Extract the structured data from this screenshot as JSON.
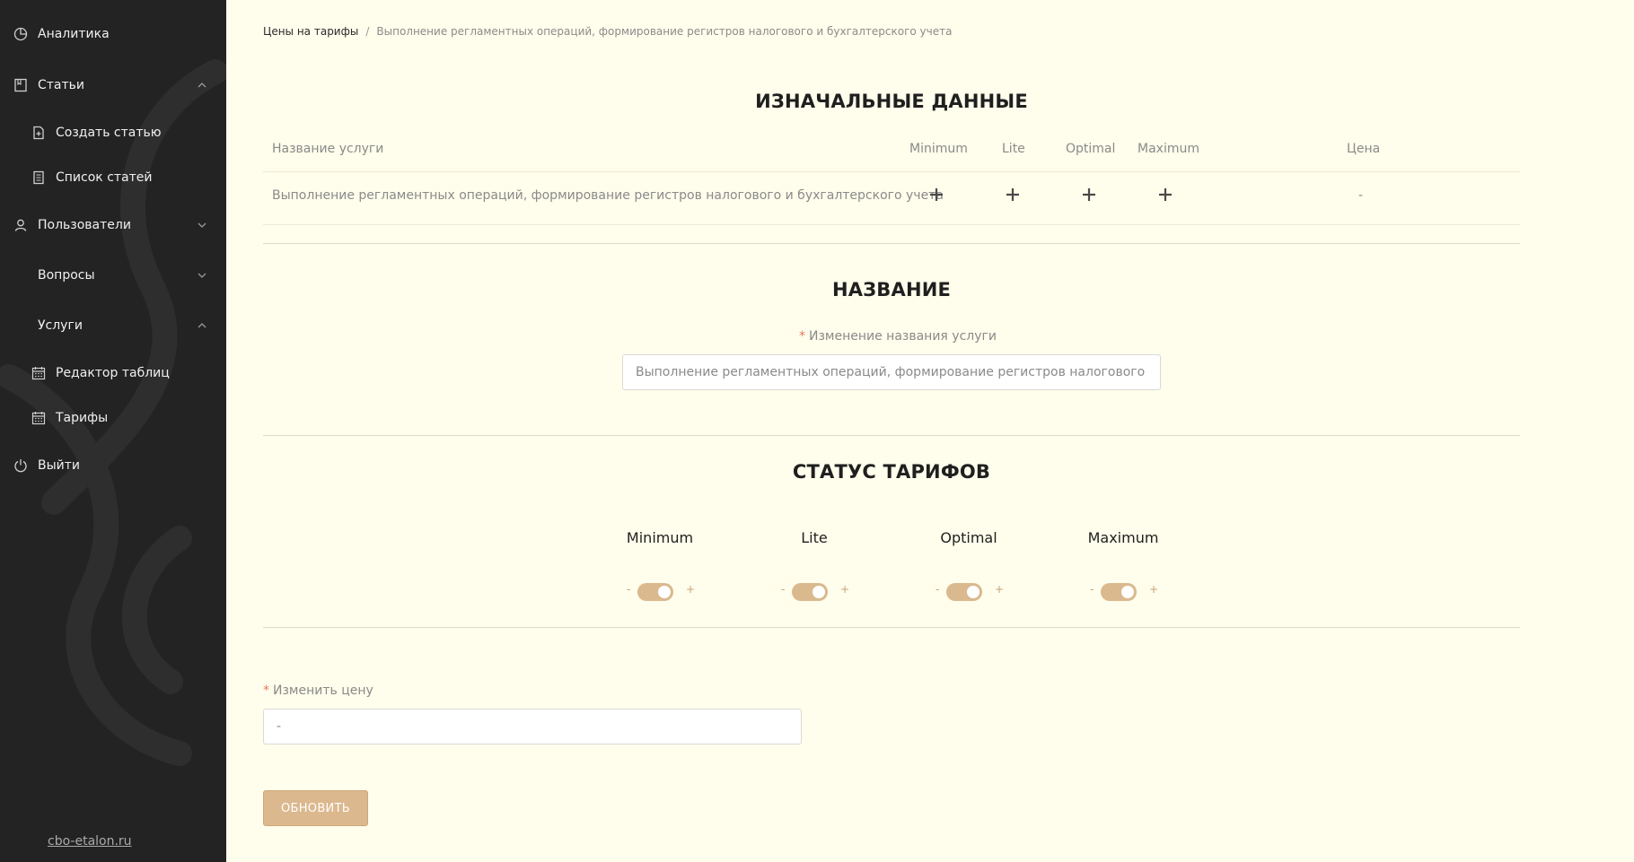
{
  "sidebar": {
    "items": [
      {
        "label": "Аналитика",
        "icon": "pie-chart-icon"
      },
      {
        "label": "Статьи",
        "icon": "book-icon",
        "chevron": "up"
      },
      {
        "label": "Создать статью",
        "icon": "file-add-icon"
      },
      {
        "label": "Список статей",
        "icon": "file-list-icon"
      },
      {
        "label": "Пользователи",
        "icon": "user-icon",
        "chevron": "down"
      },
      {
        "label": "Вопросы",
        "chevron": "down"
      },
      {
        "label": "Услуги",
        "chevron": "up"
      },
      {
        "label": "Редактор таблиц",
        "icon": "calendar-icon"
      },
      {
        "label": "Тарифы",
        "icon": "calendar-icon"
      },
      {
        "label": "Выйти",
        "icon": "power-icon"
      }
    ],
    "site_link": "cbo-etalon.ru"
  },
  "breadcrumb": {
    "root": "Цены на тарифы",
    "separator": "/",
    "current": "Выполнение регламентных операций, формирование регистров налогового и бухгалтерского учета"
  },
  "initial": {
    "title": "ИЗНАЧАЛЬНЫЕ ДАННЫЕ",
    "columns": [
      "Название услуги",
      "Minimum",
      "Lite",
      "Optimal",
      "Maximum",
      "Цена"
    ],
    "row": {
      "service": "Выполнение регламентных операций, формирование регистров налогового и бухгалтерского учета",
      "price": "-"
    }
  },
  "name_section": {
    "title": "НАЗВАНИЕ",
    "label": "Изменение названия услуги",
    "value": "Выполнение регламентных операций, формирование регистров налогового и бухгалтерского учета"
  },
  "status": {
    "title": "СТАТУС ТАРИФОВ",
    "minus": "-",
    "plus": "+",
    "tariffs": [
      {
        "name": "Minimum",
        "on": true
      },
      {
        "name": "Lite",
        "on": true
      },
      {
        "name": "Optimal",
        "on": true
      },
      {
        "name": "Maximum",
        "on": true
      }
    ]
  },
  "price_field": {
    "label": "Изменить цену",
    "value": "-"
  },
  "update_button": "ОБНОВИТЬ",
  "colors": {
    "sidebar_bg": "#232323",
    "page_bg": "#fffdeb",
    "accent": "#dab98e",
    "required": "#e8795f"
  }
}
